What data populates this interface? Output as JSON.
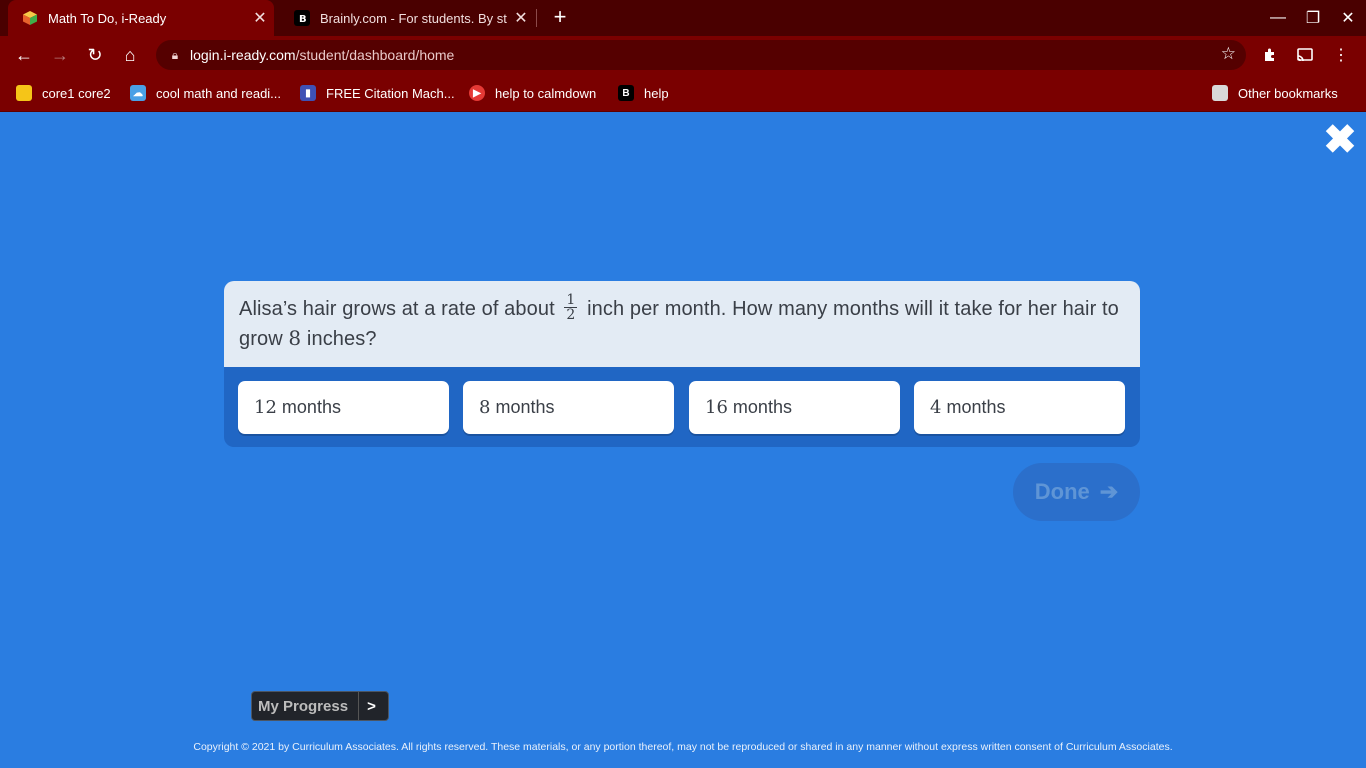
{
  "browser": {
    "tabs": [
      {
        "title": "Math To Do, i-Ready",
        "close": "✕",
        "favicon": "iready-cube-icon"
      },
      {
        "title": "Brainly.com - For students. By students",
        "close": "✕",
        "favicon": "brainly-icon"
      }
    ],
    "new_tab": "+",
    "window_controls": {
      "minimize": "—",
      "restore": "❐",
      "close": "✕"
    },
    "nav": {
      "back": "←",
      "forward": "→",
      "reload": "↻",
      "home": "⌂"
    },
    "url": {
      "host": "login.i-ready.com",
      "path": "/student/dashboard/home"
    },
    "bookmarks": [
      {
        "label": "core1 core2",
        "icon_color": "#f5c518"
      },
      {
        "label": "cool math and readi...",
        "icon_color": "#4aa0e6"
      },
      {
        "label": "FREE Citation Mach...",
        "icon_color": "#3f51b5"
      },
      {
        "label": "help to calmdown",
        "icon_color": "#e53935"
      },
      {
        "label": "help",
        "icon_color": "#000000"
      }
    ],
    "other_bookmarks": "Other bookmarks"
  },
  "lesson": {
    "close_symbol": "✖",
    "question": {
      "part1": "Alisa’s hair grows at a rate of about",
      "frac_num": "1",
      "frac_den": "2",
      "part2": "inch per month. How many months will it take for her hair to grow",
      "number": "8",
      "part3": "inches?"
    },
    "answers": [
      {
        "num": "12",
        "unit": "months"
      },
      {
        "num": "8",
        "unit": "months"
      },
      {
        "num": "16",
        "unit": "months"
      },
      {
        "num": "4",
        "unit": "months"
      }
    ],
    "done_label": "Done",
    "done_arrow": "➔",
    "my_progress": "My Progress",
    "my_progress_chevron": ">",
    "copyright": "Copyright © 2021 by Curriculum Associates. All rights reserved. These materials, or any portion thereof, may not be reproduced or shared in any manner without express written consent of Curriculum Associates."
  },
  "colors": {
    "page_background": "#2a7de1",
    "browser_theme": "#7a0000",
    "question_card": "#e3ebf4"
  }
}
